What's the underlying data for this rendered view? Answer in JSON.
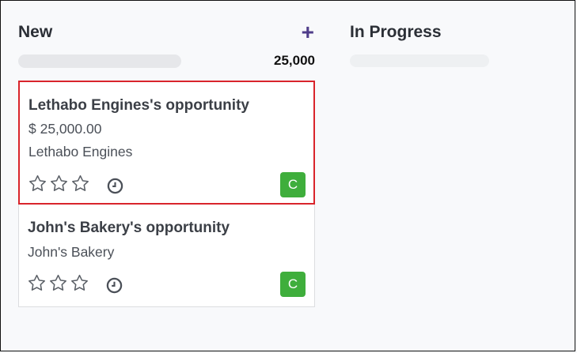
{
  "columns": [
    {
      "title": "New",
      "add_icon": "+",
      "total": "25,000"
    },
    {
      "title": "In Progress"
    }
  ],
  "cards": [
    {
      "title": "Lethabo Engines's opportunity",
      "amount": "$ 25,000.00",
      "company": "Lethabo Engines",
      "avatar": "C",
      "selected": true
    },
    {
      "title": "John's Bakery's opportunity",
      "company": "John's Bakery",
      "avatar": "C",
      "selected": false
    }
  ],
  "colors": {
    "accent": "#4f3d8a",
    "selection": "#d9242b",
    "avatar": "#3fae3c"
  },
  "icons": [
    "plus-icon",
    "star-icon",
    "clock-icon"
  ]
}
